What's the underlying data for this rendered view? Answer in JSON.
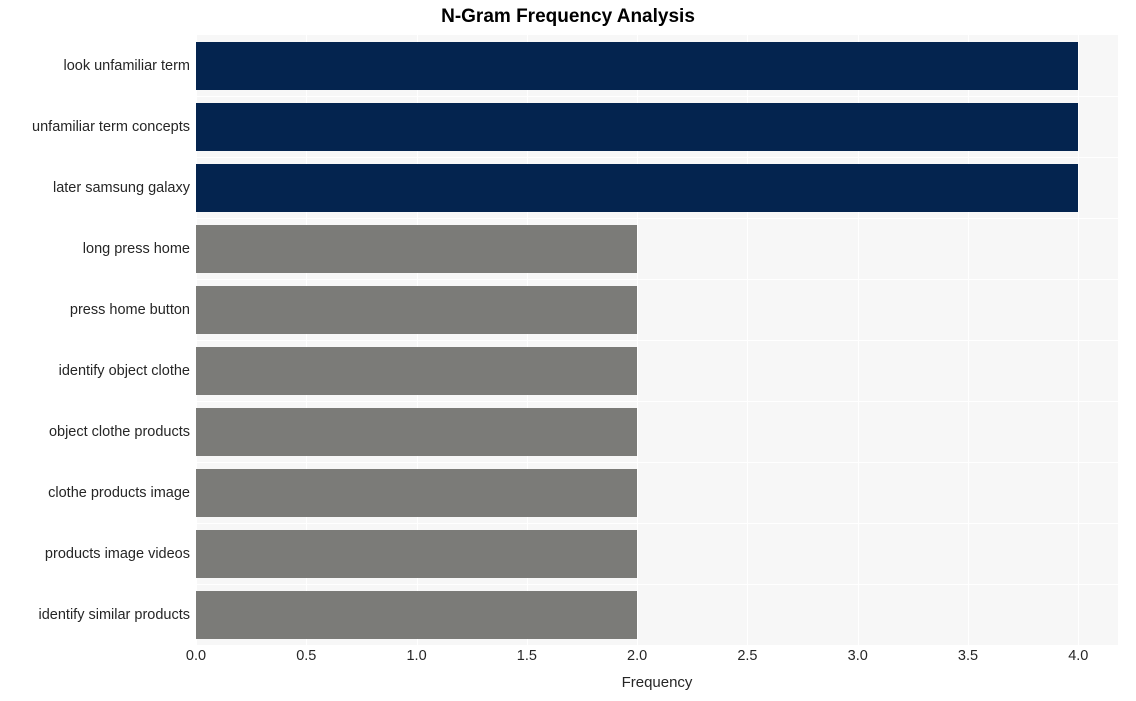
{
  "chart_data": {
    "type": "bar",
    "orientation": "horizontal",
    "title": "N-Gram Frequency Analysis",
    "xlabel": "Frequency",
    "ylabel": "",
    "categories": [
      "look unfamiliar term",
      "unfamiliar term concepts",
      "later samsung galaxy",
      "long press home",
      "press home button",
      "identify object clothe",
      "object clothe products",
      "clothe products image",
      "products image videos",
      "identify similar products"
    ],
    "values": [
      4,
      4,
      4,
      2,
      2,
      2,
      2,
      2,
      2,
      2
    ],
    "bar_colors": [
      "#04244f",
      "#04244f",
      "#04244f",
      "#7b7b78",
      "#7b7b78",
      "#7b7b78",
      "#7b7b78",
      "#7b7b78",
      "#7b7b78",
      "#7b7b78"
    ],
    "xlim": [
      0.0,
      4.18
    ],
    "xticks": [
      0.0,
      0.5,
      1.0,
      1.5,
      2.0,
      2.5,
      3.0,
      3.5,
      4.0
    ],
    "xticklabels": [
      "0.0",
      "0.5",
      "1.0",
      "1.5",
      "2.0",
      "2.5",
      "3.0",
      "3.5",
      "4.0"
    ],
    "grid": true,
    "grid_color": "#ffffff",
    "plot_background": "#f7f7f7",
    "figure_background": "#ffffff",
    "legend": null,
    "highlight_color": "#04244f",
    "default_color": "#7b7b78"
  }
}
